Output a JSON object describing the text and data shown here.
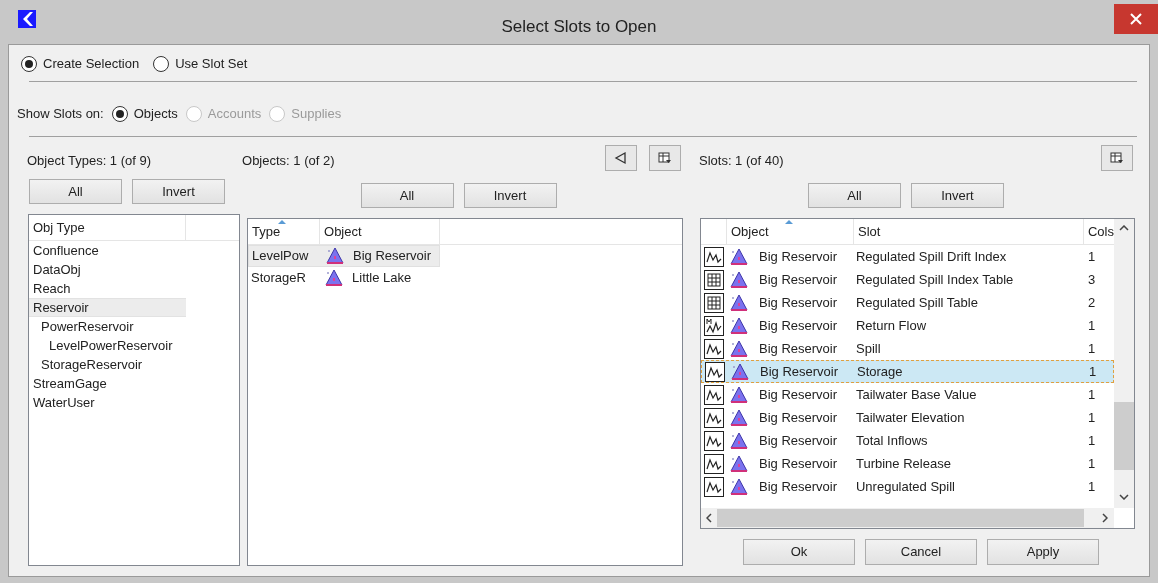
{
  "window": {
    "title": "Select Slots to Open"
  },
  "mode": [
    {
      "label": "Create Selection",
      "selected": true
    },
    {
      "label": "Use Slot Set",
      "selected": false
    }
  ],
  "show_slots_on": {
    "label": "Show Slots on:",
    "options": [
      {
        "label": "Objects",
        "selected": true,
        "disabled": false
      },
      {
        "label": "Accounts",
        "selected": false,
        "disabled": true
      },
      {
        "label": "Supplies",
        "selected": false,
        "disabled": true
      }
    ]
  },
  "object_types": {
    "label": "Object Types: 1 (of 9)",
    "buttons": [
      "All",
      "Invert"
    ],
    "column": "Obj Type",
    "items": [
      {
        "label": "Confluence",
        "selected": false
      },
      {
        "label": "DataObj",
        "selected": false
      },
      {
        "label": "Reach",
        "selected": false
      },
      {
        "label": "Reservoir",
        "selected": true,
        "children": [
          {
            "label": "PowerReservoir",
            "selected": false,
            "children": [
              {
                "label": "LevelPowerReservoir",
                "selected": false
              }
            ]
          },
          {
            "label": "StorageReservoir",
            "selected": false
          }
        ]
      },
      {
        "label": "StreamGage",
        "selected": false
      },
      {
        "label": "WaterUser",
        "selected": false
      }
    ]
  },
  "objects": {
    "label": "Objects: 1 (of 2)",
    "buttons": [
      "All",
      "Invert"
    ],
    "columns": [
      "Type",
      "Object"
    ],
    "rows": [
      {
        "type": "LevelPow",
        "object": "Big Reservoir",
        "selected": true
      },
      {
        "type": "StorageR",
        "object": "Little Lake",
        "selected": false
      }
    ]
  },
  "slots": {
    "label": "Slots: 1 (of 40)",
    "buttons": [
      "All",
      "Invert"
    ],
    "columns": [
      "Object",
      "Slot",
      "Cols"
    ],
    "rows": [
      {
        "kind": "series",
        "object": "Big Reservoir",
        "slot": "Regulated Spill Drift Index",
        "cols": "1",
        "selected": false
      },
      {
        "kind": "table",
        "object": "Big Reservoir",
        "slot": "Regulated Spill Index Table",
        "cols": "3",
        "selected": false
      },
      {
        "kind": "table",
        "object": "Big Reservoir",
        "slot": "Regulated Spill Table",
        "cols": "2",
        "selected": false
      },
      {
        "kind": "multi",
        "object": "Big Reservoir",
        "slot": "Return Flow",
        "cols": "1",
        "selected": false
      },
      {
        "kind": "series",
        "object": "Big Reservoir",
        "slot": "Spill",
        "cols": "1",
        "selected": false
      },
      {
        "kind": "series",
        "object": "Big Reservoir",
        "slot": "Storage",
        "cols": "1",
        "selected": true
      },
      {
        "kind": "series",
        "object": "Big Reservoir",
        "slot": "Tailwater Base Value",
        "cols": "1",
        "selected": false
      },
      {
        "kind": "series",
        "object": "Big Reservoir",
        "slot": "Tailwater Elevation",
        "cols": "1",
        "selected": false
      },
      {
        "kind": "series",
        "object": "Big Reservoir",
        "slot": "Total Inflows",
        "cols": "1",
        "selected": false
      },
      {
        "kind": "series",
        "object": "Big Reservoir",
        "slot": "Turbine Release",
        "cols": "1",
        "selected": false
      },
      {
        "kind": "series",
        "object": "Big Reservoir",
        "slot": "Unregulated Spill",
        "cols": "1",
        "selected": false
      }
    ]
  },
  "footer_buttons": [
    "Ok",
    "Cancel",
    "Apply"
  ]
}
